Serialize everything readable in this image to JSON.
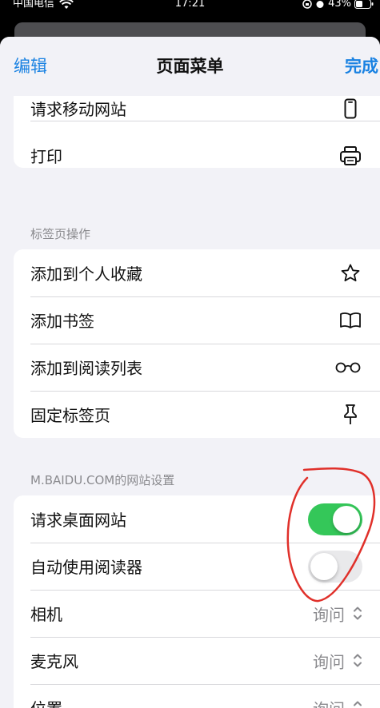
{
  "status_bar": {
    "carrier": "中国电信",
    "time": "17:21",
    "battery": "43%"
  },
  "nav": {
    "edit_label": "编辑",
    "title": "页面菜单",
    "done_label": "完成"
  },
  "top_group": {
    "items": [
      {
        "label": "请求移动网站",
        "icon": "phone-icon"
      },
      {
        "label": "打印",
        "icon": "printer-icon"
      }
    ]
  },
  "tab_actions": {
    "header": "标签页操作",
    "items": [
      {
        "label": "添加到个人收藏",
        "icon": "star-icon"
      },
      {
        "label": "添加书签",
        "icon": "book-icon"
      },
      {
        "label": "添加到阅读列表",
        "icon": "glasses-icon"
      },
      {
        "label": "固定标签页",
        "icon": "pin-icon"
      }
    ]
  },
  "site_settings": {
    "header": "M.BAIDU.COM的网站设置",
    "items": [
      {
        "label": "请求桌面网站",
        "type": "toggle",
        "on": true
      },
      {
        "label": "自动使用阅读器",
        "type": "toggle",
        "on": false
      },
      {
        "label": "相机",
        "type": "select",
        "value": "询问"
      },
      {
        "label": "麦克风",
        "type": "select",
        "value": "询问"
      },
      {
        "label": "位置",
        "type": "select",
        "value": "询问"
      }
    ]
  },
  "colors": {
    "accent": "#1a82e2",
    "toggle_on": "#34c759",
    "annotation": "#e0302a"
  }
}
